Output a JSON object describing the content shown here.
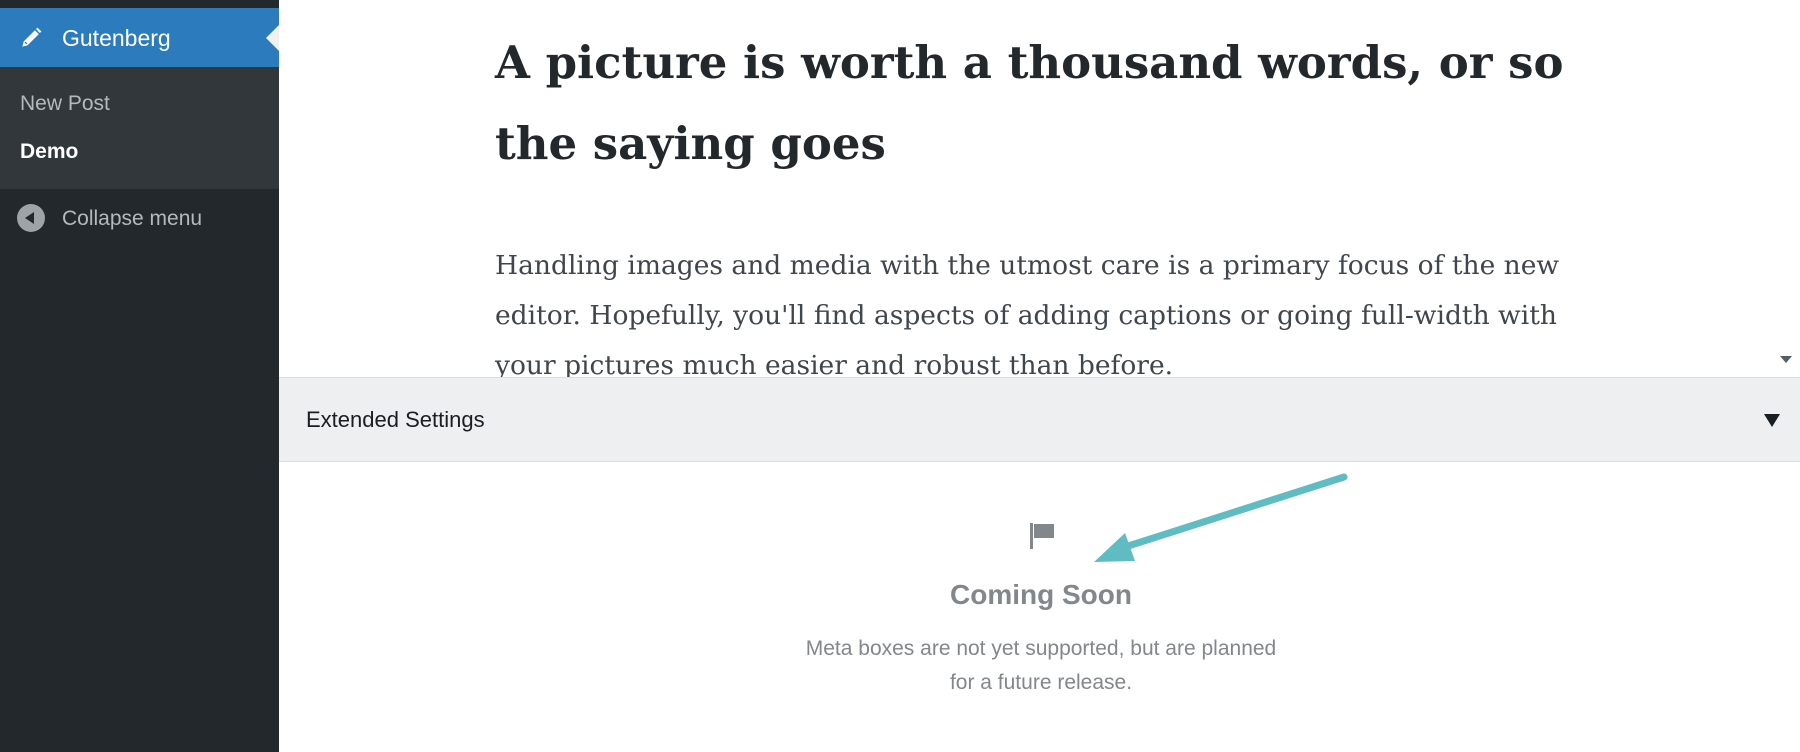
{
  "sidebar": {
    "active_item": {
      "label": "Gutenberg",
      "icon": "pencil-icon"
    },
    "submenu": [
      "New Post",
      "Demo"
    ],
    "collapse_label": "Collapse menu"
  },
  "editor": {
    "title": "A picture is worth a thousand words, or so the saying goes",
    "paragraph": "Handling images and media with the utmost care is a primary focus of the new editor. Hopefully, you'll find aspects of adding captions or going full-width with your pictures much easier and robust than before."
  },
  "extended_settings": {
    "title": "Extended Settings",
    "notice": {
      "icon": "flag-icon",
      "heading": "Coming Soon",
      "line1": "Meta boxes are not yet supported, but are planned",
      "line2": "for a future release."
    }
  },
  "colors": {
    "sidebar_bg": "#23282d",
    "active_item_bg": "#2c7bbd",
    "submenu_bg": "#32373c",
    "panel_header_bg": "#edeff0",
    "annotation_arrow": "#5fbcc2"
  }
}
